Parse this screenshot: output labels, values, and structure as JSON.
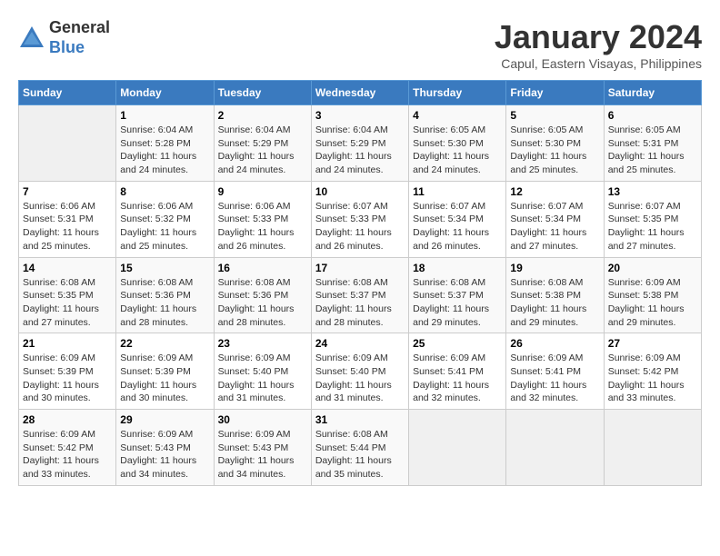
{
  "logo": {
    "general": "General",
    "blue": "Blue"
  },
  "title": "January 2024",
  "subtitle": "Capul, Eastern Visayas, Philippines",
  "days_of_week": [
    "Sunday",
    "Monday",
    "Tuesday",
    "Wednesday",
    "Thursday",
    "Friday",
    "Saturday"
  ],
  "weeks": [
    [
      {
        "num": "",
        "sunrise": "",
        "sunset": "",
        "daylight": ""
      },
      {
        "num": "1",
        "sunrise": "Sunrise: 6:04 AM",
        "sunset": "Sunset: 5:28 PM",
        "daylight": "Daylight: 11 hours and 24 minutes."
      },
      {
        "num": "2",
        "sunrise": "Sunrise: 6:04 AM",
        "sunset": "Sunset: 5:29 PM",
        "daylight": "Daylight: 11 hours and 24 minutes."
      },
      {
        "num": "3",
        "sunrise": "Sunrise: 6:04 AM",
        "sunset": "Sunset: 5:29 PM",
        "daylight": "Daylight: 11 hours and 24 minutes."
      },
      {
        "num": "4",
        "sunrise": "Sunrise: 6:05 AM",
        "sunset": "Sunset: 5:30 PM",
        "daylight": "Daylight: 11 hours and 24 minutes."
      },
      {
        "num": "5",
        "sunrise": "Sunrise: 6:05 AM",
        "sunset": "Sunset: 5:30 PM",
        "daylight": "Daylight: 11 hours and 25 minutes."
      },
      {
        "num": "6",
        "sunrise": "Sunrise: 6:05 AM",
        "sunset": "Sunset: 5:31 PM",
        "daylight": "Daylight: 11 hours and 25 minutes."
      }
    ],
    [
      {
        "num": "7",
        "sunrise": "Sunrise: 6:06 AM",
        "sunset": "Sunset: 5:31 PM",
        "daylight": "Daylight: 11 hours and 25 minutes."
      },
      {
        "num": "8",
        "sunrise": "Sunrise: 6:06 AM",
        "sunset": "Sunset: 5:32 PM",
        "daylight": "Daylight: 11 hours and 25 minutes."
      },
      {
        "num": "9",
        "sunrise": "Sunrise: 6:06 AM",
        "sunset": "Sunset: 5:33 PM",
        "daylight": "Daylight: 11 hours and 26 minutes."
      },
      {
        "num": "10",
        "sunrise": "Sunrise: 6:07 AM",
        "sunset": "Sunset: 5:33 PM",
        "daylight": "Daylight: 11 hours and 26 minutes."
      },
      {
        "num": "11",
        "sunrise": "Sunrise: 6:07 AM",
        "sunset": "Sunset: 5:34 PM",
        "daylight": "Daylight: 11 hours and 26 minutes."
      },
      {
        "num": "12",
        "sunrise": "Sunrise: 6:07 AM",
        "sunset": "Sunset: 5:34 PM",
        "daylight": "Daylight: 11 hours and 27 minutes."
      },
      {
        "num": "13",
        "sunrise": "Sunrise: 6:07 AM",
        "sunset": "Sunset: 5:35 PM",
        "daylight": "Daylight: 11 hours and 27 minutes."
      }
    ],
    [
      {
        "num": "14",
        "sunrise": "Sunrise: 6:08 AM",
        "sunset": "Sunset: 5:35 PM",
        "daylight": "Daylight: 11 hours and 27 minutes."
      },
      {
        "num": "15",
        "sunrise": "Sunrise: 6:08 AM",
        "sunset": "Sunset: 5:36 PM",
        "daylight": "Daylight: 11 hours and 28 minutes."
      },
      {
        "num": "16",
        "sunrise": "Sunrise: 6:08 AM",
        "sunset": "Sunset: 5:36 PM",
        "daylight": "Daylight: 11 hours and 28 minutes."
      },
      {
        "num": "17",
        "sunrise": "Sunrise: 6:08 AM",
        "sunset": "Sunset: 5:37 PM",
        "daylight": "Daylight: 11 hours and 28 minutes."
      },
      {
        "num": "18",
        "sunrise": "Sunrise: 6:08 AM",
        "sunset": "Sunset: 5:37 PM",
        "daylight": "Daylight: 11 hours and 29 minutes."
      },
      {
        "num": "19",
        "sunrise": "Sunrise: 6:08 AM",
        "sunset": "Sunset: 5:38 PM",
        "daylight": "Daylight: 11 hours and 29 minutes."
      },
      {
        "num": "20",
        "sunrise": "Sunrise: 6:09 AM",
        "sunset": "Sunset: 5:38 PM",
        "daylight": "Daylight: 11 hours and 29 minutes."
      }
    ],
    [
      {
        "num": "21",
        "sunrise": "Sunrise: 6:09 AM",
        "sunset": "Sunset: 5:39 PM",
        "daylight": "Daylight: 11 hours and 30 minutes."
      },
      {
        "num": "22",
        "sunrise": "Sunrise: 6:09 AM",
        "sunset": "Sunset: 5:39 PM",
        "daylight": "Daylight: 11 hours and 30 minutes."
      },
      {
        "num": "23",
        "sunrise": "Sunrise: 6:09 AM",
        "sunset": "Sunset: 5:40 PM",
        "daylight": "Daylight: 11 hours and 31 minutes."
      },
      {
        "num": "24",
        "sunrise": "Sunrise: 6:09 AM",
        "sunset": "Sunset: 5:40 PM",
        "daylight": "Daylight: 11 hours and 31 minutes."
      },
      {
        "num": "25",
        "sunrise": "Sunrise: 6:09 AM",
        "sunset": "Sunset: 5:41 PM",
        "daylight": "Daylight: 11 hours and 32 minutes."
      },
      {
        "num": "26",
        "sunrise": "Sunrise: 6:09 AM",
        "sunset": "Sunset: 5:41 PM",
        "daylight": "Daylight: 11 hours and 32 minutes."
      },
      {
        "num": "27",
        "sunrise": "Sunrise: 6:09 AM",
        "sunset": "Sunset: 5:42 PM",
        "daylight": "Daylight: 11 hours and 33 minutes."
      }
    ],
    [
      {
        "num": "28",
        "sunrise": "Sunrise: 6:09 AM",
        "sunset": "Sunset: 5:42 PM",
        "daylight": "Daylight: 11 hours and 33 minutes."
      },
      {
        "num": "29",
        "sunrise": "Sunrise: 6:09 AM",
        "sunset": "Sunset: 5:43 PM",
        "daylight": "Daylight: 11 hours and 34 minutes."
      },
      {
        "num": "30",
        "sunrise": "Sunrise: 6:09 AM",
        "sunset": "Sunset: 5:43 PM",
        "daylight": "Daylight: 11 hours and 34 minutes."
      },
      {
        "num": "31",
        "sunrise": "Sunrise: 6:08 AM",
        "sunset": "Sunset: 5:44 PM",
        "daylight": "Daylight: 11 hours and 35 minutes."
      },
      {
        "num": "",
        "sunrise": "",
        "sunset": "",
        "daylight": ""
      },
      {
        "num": "",
        "sunrise": "",
        "sunset": "",
        "daylight": ""
      },
      {
        "num": "",
        "sunrise": "",
        "sunset": "",
        "daylight": ""
      }
    ]
  ]
}
